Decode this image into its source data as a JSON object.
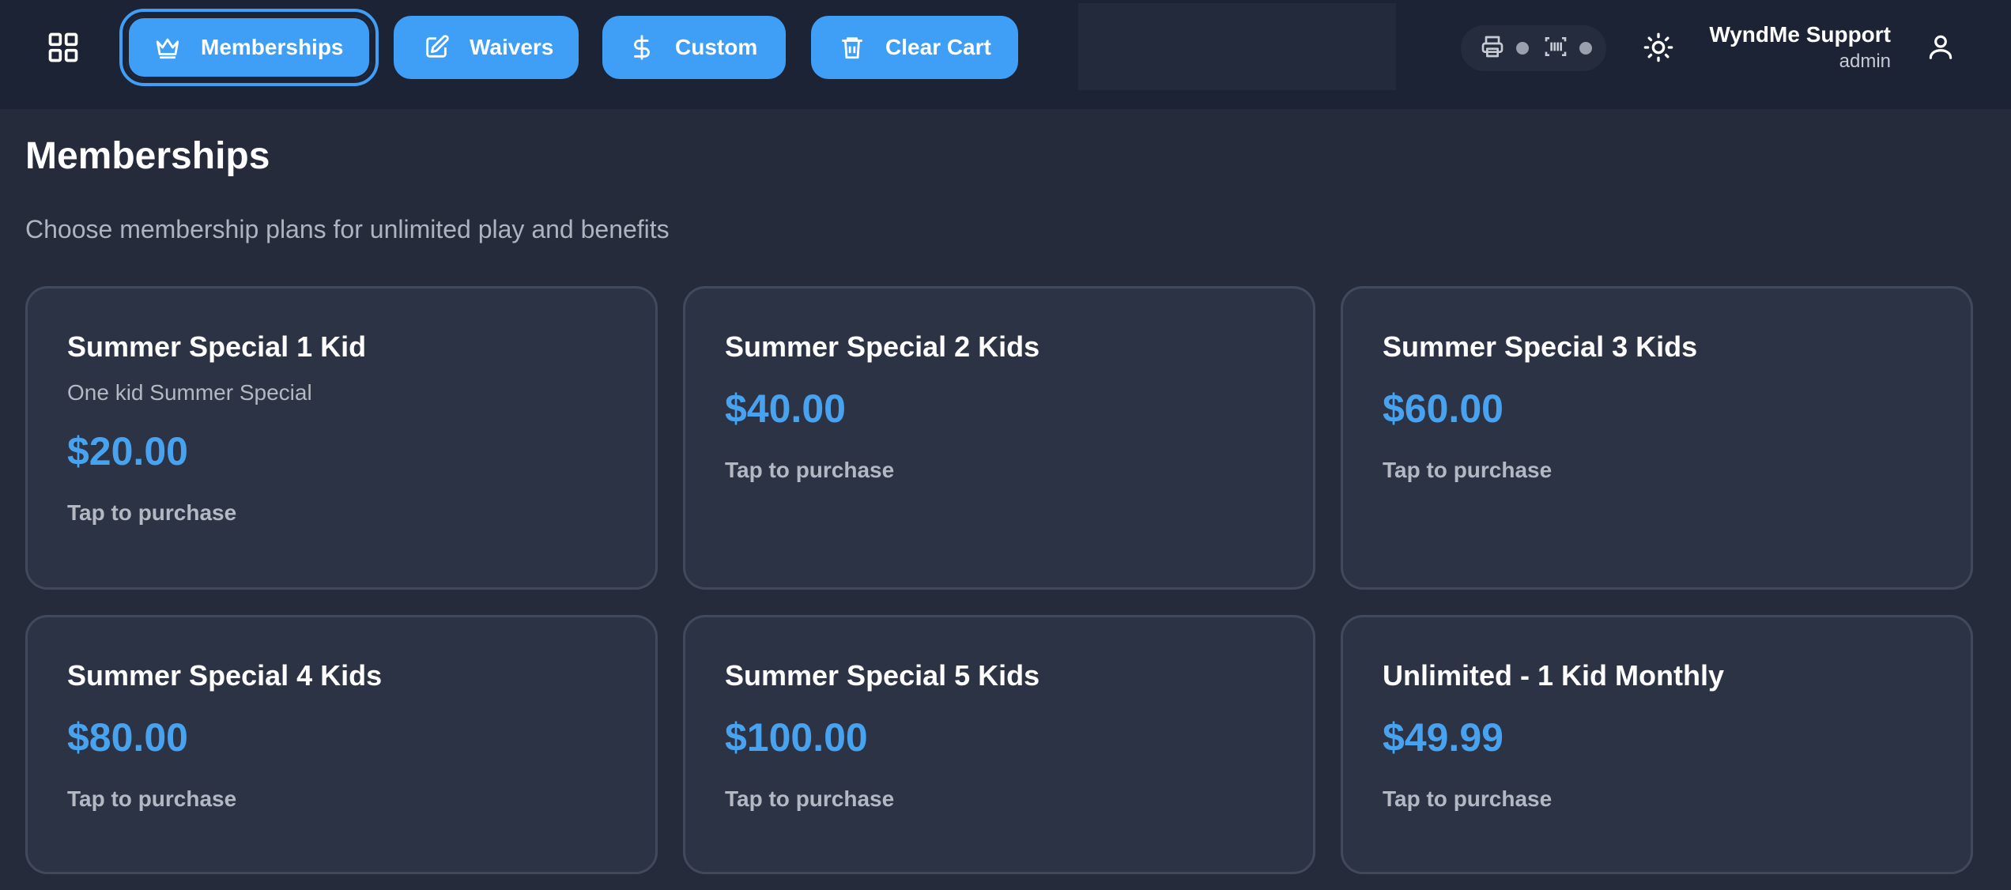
{
  "toolbar": {
    "buttons": [
      {
        "label": "Memberships",
        "icon": "crown-icon",
        "active": true
      },
      {
        "label": "Waivers",
        "icon": "edit-icon",
        "active": false
      },
      {
        "label": "Custom",
        "icon": "dollar-icon",
        "active": false
      },
      {
        "label": "Clear Cart",
        "icon": "trash-icon",
        "active": false
      }
    ],
    "device_status": {
      "printer_icon": "printer-icon",
      "scanner_icon": "barcode-scanner-icon"
    },
    "theme_icon": "sun-icon",
    "user": {
      "name": "WyndMe Support",
      "role": "admin",
      "icon": "user-icon"
    }
  },
  "page": {
    "title": "Memberships",
    "subtitle": "Choose membership plans for unlimited play and benefits"
  },
  "cards": [
    {
      "title": "Summer Special 1 Kid",
      "description": "One kid Summer Special",
      "price": "$20.00",
      "cta": "Tap to purchase"
    },
    {
      "title": "Summer Special 2 Kids",
      "description": "",
      "price": "$40.00",
      "cta": "Tap to purchase"
    },
    {
      "title": "Summer Special 3 Kids",
      "description": "",
      "price": "$60.00",
      "cta": "Tap to purchase"
    },
    {
      "title": "Summer Special 4 Kids",
      "description": "",
      "price": "$80.00",
      "cta": "Tap to purchase"
    },
    {
      "title": "Summer Special 5 Kids",
      "description": "",
      "price": "$100.00",
      "cta": "Tap to purchase"
    },
    {
      "title": "Unlimited - 1 Kid Monthly",
      "description": "",
      "price": "$49.99",
      "cta": "Tap to purchase"
    }
  ],
  "colors": {
    "accent": "#3f9ef6",
    "price": "#47a3ef",
    "background": "#252b3b",
    "topbar": "#1c2335",
    "card": "#2c3345"
  }
}
